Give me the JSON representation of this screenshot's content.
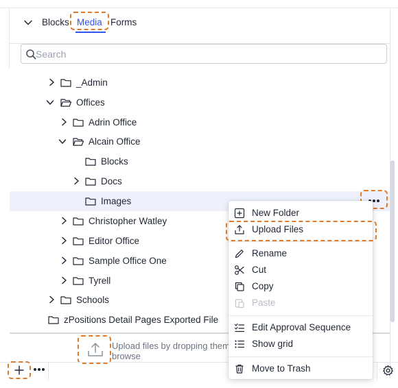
{
  "tabs": {
    "blocks": "Blocks",
    "media": "Media",
    "forms": "Forms"
  },
  "search": {
    "placeholder": "Search",
    "value": ""
  },
  "tree": {
    "items": [
      {
        "label": "_Admin"
      },
      {
        "label": "Offices"
      },
      {
        "label": "Adrin Office"
      },
      {
        "label": "Alcain Office"
      },
      {
        "label": "Blocks"
      },
      {
        "label": "Docs"
      },
      {
        "label": "Images"
      },
      {
        "label": "Christopher Watley"
      },
      {
        "label": "Editor Office"
      },
      {
        "label": "Sample Office One"
      },
      {
        "label": "Tyrell"
      },
      {
        "label": "Schools"
      },
      {
        "label": "zPositions Detail Pages Exported File"
      }
    ]
  },
  "context_menu": {
    "new_folder": "New Folder",
    "upload_files": "Upload Files",
    "rename": "Rename",
    "cut": "Cut",
    "copy": "Copy",
    "paste": "Paste",
    "edit_approval": "Edit Approval Sequence",
    "show_grid": "Show grid",
    "move_to_trash": "Move to Trash"
  },
  "upload": {
    "line1": "Upload files by dropping them",
    "line2": "browse"
  },
  "colors": {
    "accent": "#2f54eb",
    "highlight": "#e07a26",
    "selected_row": "#eef1fb"
  }
}
